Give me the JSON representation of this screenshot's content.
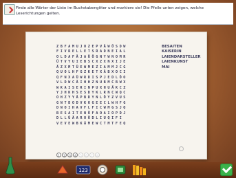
{
  "instruction": "Finde alle Wörter der Liste im Buchstabengitter und markiere sie! Die Pfeile unten zeigen, welche Leserichtungen gelten.",
  "grid": [
    "ZBFAMUJOZEPVÄWÖSDW",
    "FIVRELLETSRADNEIAL",
    "OLDAFÄJAÜÖGNYWNOMR",
    "ÜTVYUIEBSCXZXNXIJE",
    "ÄZXMTÜEWMEZIAMMJCG",
    "QUOLHFGZKETXÄBXOCI",
    "QFNXAÜWRDISPJEDLÖO",
    "VLDWCÄIHHZNUBMCBWX",
    "WKAISERINPUXHUÄKCZ",
    "YJHKHSESDYKLRNCWQC",
    "OHZYYÄPBDYNLÖYZVUS",
    "GNTDODVKOGEECLWHFG",
    "DNOIHAVFLFICWMGSJQ",
    "BESAITENÖFAOAIOPDJ",
    "DLLÜÄAROÖDLIUQIFI",
    "VEVEWBKÄMEWCTMTFEQ"
  ],
  "word_list": [
    "BESAITEN",
    "KAISERIN",
    "LAIENDARSTELLER",
    "LAIENKUNST",
    "MAI"
  ],
  "page_dots": [
    "1",
    "2",
    "3",
    "4",
    "5",
    "6",
    "7",
    "8"
  ],
  "filled_dots": 4
}
